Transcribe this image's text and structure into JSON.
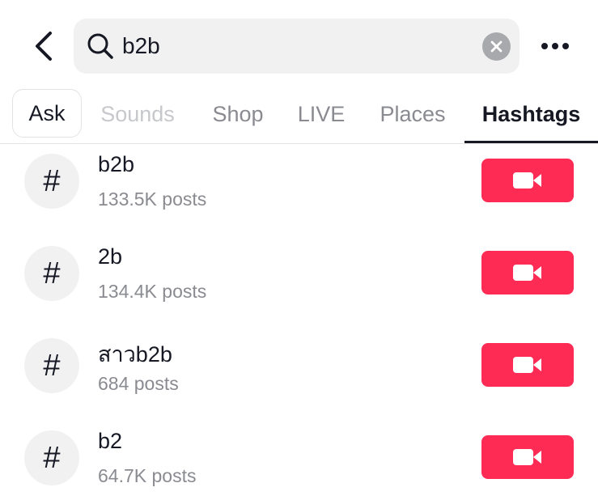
{
  "header": {
    "back_icon": "chevron-left-icon",
    "search": {
      "value": "b2b",
      "icon": "search-icon",
      "clear_icon": "clear-x-icon"
    },
    "more_icon": "more-horizontal-icon"
  },
  "tabs": [
    {
      "label": "Ask",
      "selected": false
    },
    {
      "label": "Sounds",
      "selected": false
    },
    {
      "label": "Shop",
      "selected": false
    },
    {
      "label": "LIVE",
      "selected": false
    },
    {
      "label": "Places",
      "selected": false
    },
    {
      "label": "Hashtags",
      "selected": true
    }
  ],
  "hashtags": [
    {
      "symbol": "#",
      "name": "b2b",
      "count": "133.5K posts",
      "action_icon": "video-camera-icon"
    },
    {
      "symbol": "#",
      "name": "2b",
      "count": "134.4K posts",
      "action_icon": "video-camera-icon"
    },
    {
      "symbol": "#",
      "name": "สาวb2b",
      "count": "684 posts",
      "action_icon": "video-camera-icon"
    },
    {
      "symbol": "#",
      "name": "b2",
      "count": "64.7K posts",
      "action_icon": "video-camera-icon"
    }
  ],
  "colors": {
    "accent": "#fe2c55",
    "text_primary": "#161823",
    "text_secondary": "#8a8b91",
    "surface": "#f1f1f2"
  }
}
